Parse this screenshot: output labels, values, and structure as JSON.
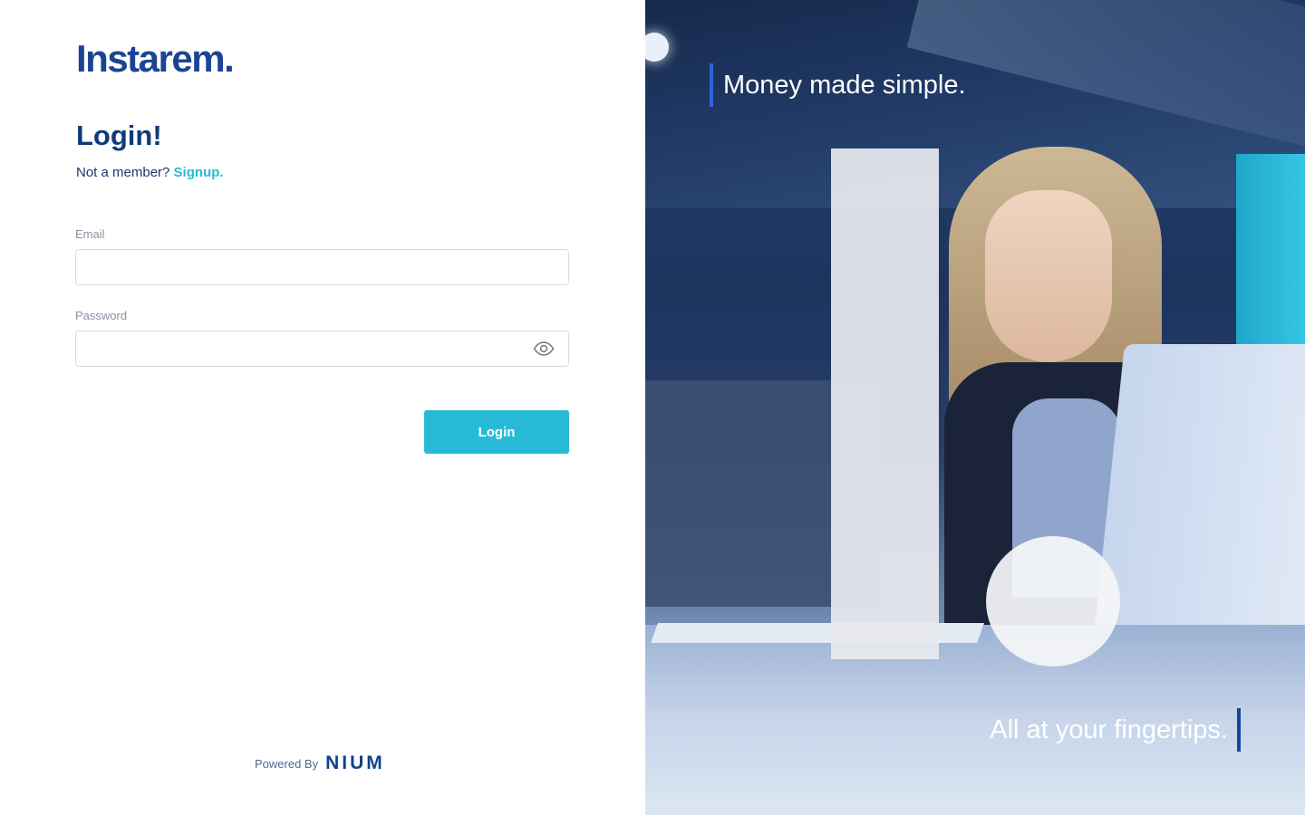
{
  "brand": {
    "logo_text": "Instarem."
  },
  "login": {
    "title": "Login!",
    "member_prompt": "Not a member? ",
    "signup_link": "Signup.",
    "email_label": "Email",
    "email_value": "",
    "email_placeholder": "",
    "password_label": "Password",
    "password_value": "",
    "password_placeholder": "",
    "password_toggle_icon": "eye-icon",
    "submit_label": "Login"
  },
  "footer": {
    "powered_by": "Powered By",
    "partner_logo": "NIUM"
  },
  "hero": {
    "headline": "Money made simple.",
    "tagline": "All at your fingertips."
  },
  "colors": {
    "brand_blue": "#1b4494",
    "accent_cyan": "#27bad6",
    "hero_overlay": "#1d355e"
  }
}
